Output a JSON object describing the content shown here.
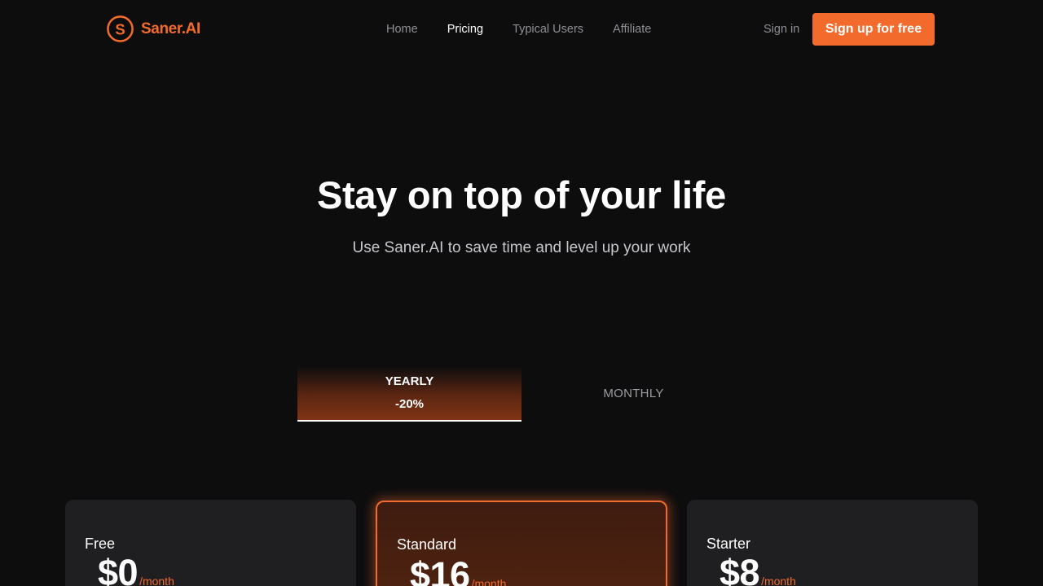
{
  "brand": {
    "name": "Saner.AI",
    "logo_letter": "S",
    "color": "#f26b2c"
  },
  "nav": {
    "items": [
      {
        "label": "Home",
        "active": false
      },
      {
        "label": "Pricing",
        "active": true
      },
      {
        "label": "Typical Users",
        "active": false
      },
      {
        "label": "Affiliate",
        "active": false
      }
    ]
  },
  "auth": {
    "sign_in": "Sign in",
    "sign_up": "Sign up for free"
  },
  "hero": {
    "title": "Stay on top of your life",
    "subtitle": "Use Saner.AI to save time and level up your work"
  },
  "billing": {
    "yearly": {
      "label": "YEARLY",
      "discount": "-20%",
      "selected": true
    },
    "monthly": {
      "label": "MONTHLY",
      "selected": false
    }
  },
  "plans": [
    {
      "name": "Free",
      "price": "$0",
      "period": "/month",
      "highlighted": false
    },
    {
      "name": "Standard",
      "price": "$16",
      "period": "/month",
      "highlighted": true
    },
    {
      "name": "Starter",
      "price": "$8",
      "period": "/month",
      "highlighted": false
    }
  ],
  "colors": {
    "accent": "#f26b2c",
    "background": "#0d0d0e",
    "card": "#1f1f21"
  }
}
